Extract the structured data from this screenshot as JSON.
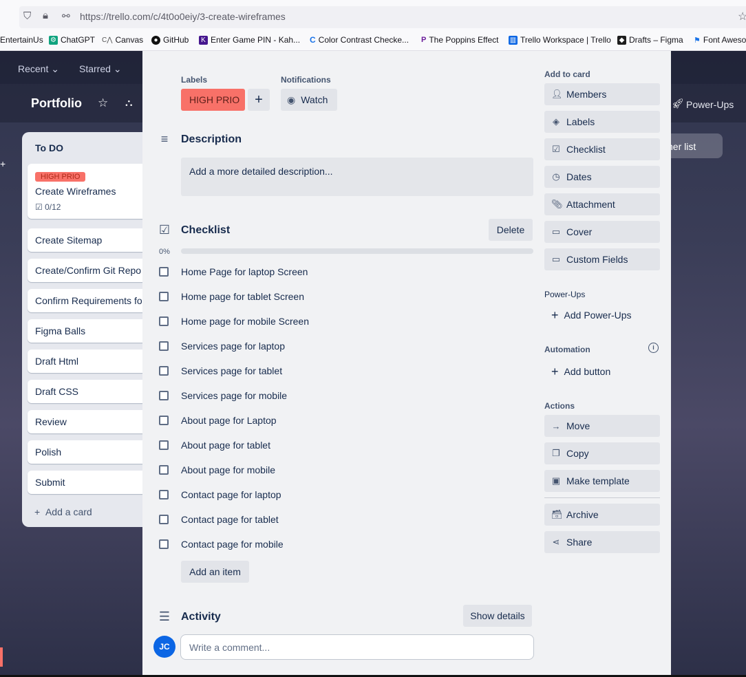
{
  "browser": {
    "url": "https://trello.com/c/4t0o0eiy/3-create-wireframes",
    "bookmarks": [
      "EntertainUs",
      "ChatGPT",
      "Canvas",
      "GitHub",
      "Enter Game PIN - Kah...",
      "Color Contrast Checke...",
      "The Poppins Effect",
      "Trello Workspace | Trello",
      "Drafts – Figma",
      "Font Aweso"
    ]
  },
  "board": {
    "nav_recent": "Recent",
    "nav_starred": "Starred",
    "title": "Portfolio",
    "powerups": "Power-Ups",
    "other_list": "her list",
    "list": {
      "title": "To DO",
      "first_card": {
        "label": "HIGH PRIO",
        "title": "Create Wireframes",
        "checklist": "0/12"
      },
      "cards": [
        "Create Sitemap",
        "Create/Confirm Git Repo",
        "Confirm Requirements for",
        "Figma Balls",
        "Draft Html",
        "Draft CSS",
        "Review",
        "Polish",
        "Submit"
      ],
      "add_card": "Add a card"
    }
  },
  "modal": {
    "labels_heading": "Labels",
    "label_value": "HIGH PRIO",
    "label_color": "#f87168",
    "notifications_heading": "Notifications",
    "watch": "Watch",
    "description_heading": "Description",
    "description_placeholder": "Add a more detailed description...",
    "checklist_heading": "Checklist",
    "delete": "Delete",
    "progress_percent": "0%",
    "progress_value": 0,
    "checklist_items": [
      "Home Page for laptop Screen",
      "Home page for tablet Screen",
      "Home page for mobile Screen",
      "Services page for laptop",
      "Services page for tablet",
      "Services page for mobile",
      "About page for Laptop",
      "About page for tablet",
      "About page for mobile",
      "Contact page for laptop",
      "Contact page for tablet",
      "Contact page for mobile"
    ],
    "add_item": "Add an item",
    "activity_heading": "Activity",
    "show_details": "Show details",
    "avatar_initials": "JC",
    "comment_placeholder": "Write a comment...",
    "sidebar": {
      "add_to_card": "Add to card",
      "members": "Members",
      "labels": "Labels",
      "checklist": "Checklist",
      "dates": "Dates",
      "attachment": "Attachment",
      "cover": "Cover",
      "custom_fields": "Custom Fields",
      "powerups_heading": "Power-Ups",
      "add_powerups": "Add Power-Ups",
      "automation_heading": "Automation",
      "add_button": "Add button",
      "actions_heading": "Actions",
      "move": "Move",
      "copy": "Copy",
      "make_template": "Make template",
      "archive": "Archive",
      "share": "Share"
    }
  }
}
